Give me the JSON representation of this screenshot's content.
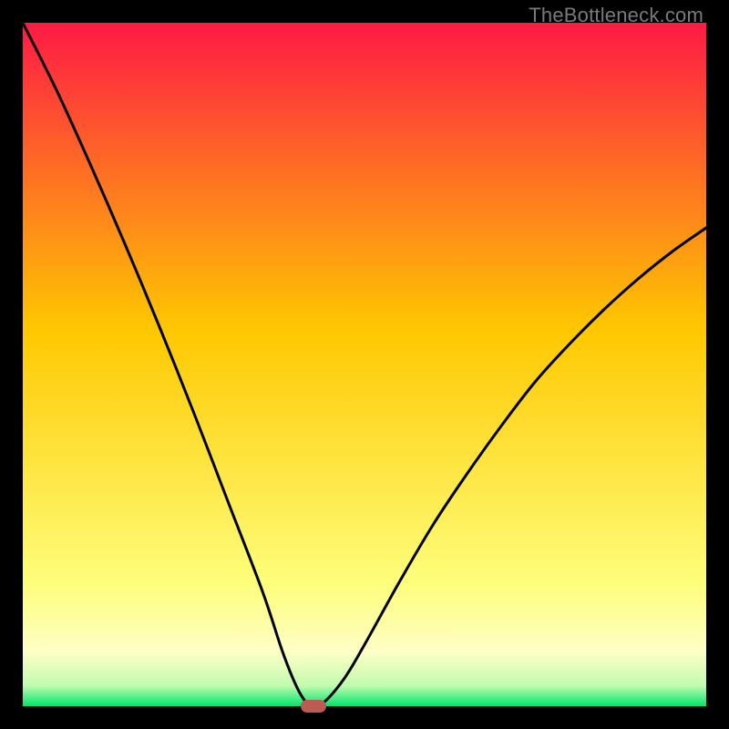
{
  "watermark": "TheBottleneck.com",
  "colors": {
    "gradient_top": "#fe1a45",
    "gradient_mid": "#fec800",
    "gradient_lower": "#feff7f",
    "gradient_bottom": "#00e46c",
    "curve": "#000000",
    "marker": "#bc5a53",
    "background": "#000000",
    "watermark": "#7a7a7a"
  },
  "chart_data": {
    "type": "line",
    "title": "",
    "xlabel": "",
    "ylabel": "",
    "xlim": [
      0,
      100
    ],
    "ylim": [
      0,
      100
    ],
    "grid": false,
    "legend": false,
    "series": [
      {
        "name": "bottleneck-curve-left",
        "x": [
          0,
          5,
          10,
          15,
          20,
          25,
          30,
          35,
          38,
          40,
          41.5,
          42.5
        ],
        "y": [
          100,
          90,
          79,
          67.5,
          55.5,
          43,
          30,
          17,
          8,
          3,
          0.5,
          0
        ]
      },
      {
        "name": "bottleneck-curve-right",
        "x": [
          42.5,
          44,
          47,
          50,
          55,
          60,
          65,
          70,
          75,
          80,
          85,
          90,
          95,
          100
        ],
        "y": [
          0,
          0.5,
          4,
          9,
          18,
          26.5,
          34,
          41,
          47.5,
          53,
          58,
          62.5,
          66.5,
          70
        ]
      }
    ],
    "marker": {
      "x": 42.5,
      "y": 0
    },
    "background_gradient_stops": [
      {
        "offset": 0,
        "color": "#fe1a45"
      },
      {
        "offset": 45,
        "color": "#fec800"
      },
      {
        "offset": 82,
        "color": "#fefe7b"
      },
      {
        "offset": 92,
        "color": "#feffc5"
      },
      {
        "offset": 97,
        "color": "#c1fcb0"
      },
      {
        "offset": 100,
        "color": "#00e46c"
      }
    ]
  }
}
